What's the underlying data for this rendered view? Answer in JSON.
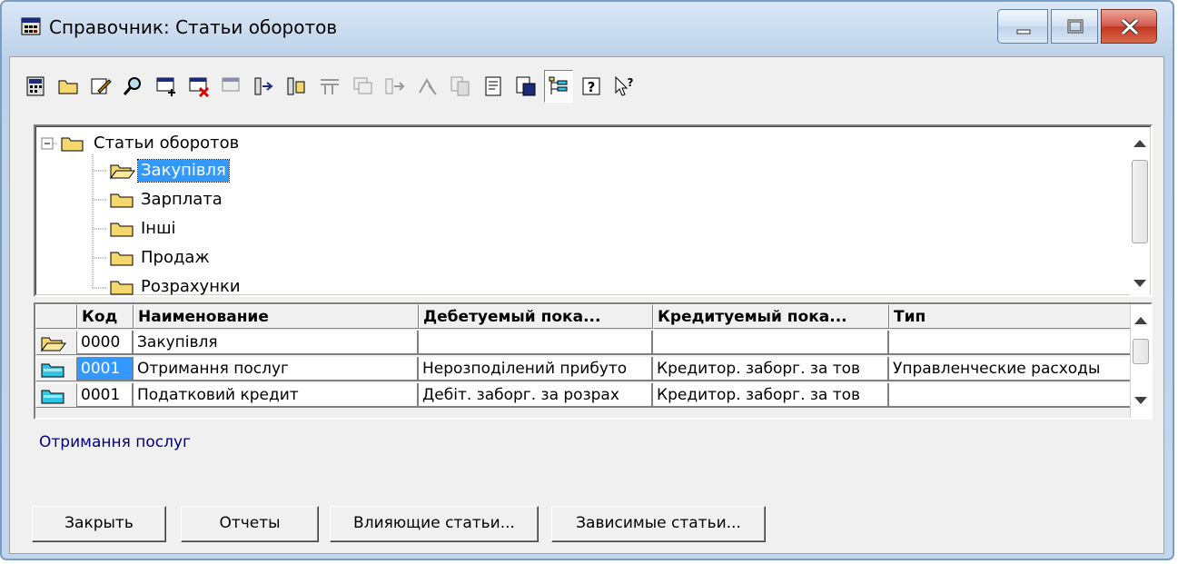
{
  "window": {
    "title": "Справочник: Статьи оборотов"
  },
  "toolbar": {
    "buttons": [
      {
        "icon": "calculator-icon"
      },
      {
        "icon": "folder-icon"
      },
      {
        "icon": "edit-card-icon"
      },
      {
        "icon": "find-icon"
      },
      {
        "icon": "new-record-icon"
      },
      {
        "icon": "delete-record-icon"
      },
      {
        "icon": "copy-record-icon"
      },
      {
        "icon": "move-to-folder-icon"
      },
      {
        "icon": "move-to-parent-icon"
      },
      {
        "icon": "filter-icon"
      },
      {
        "icon": "group-icon"
      },
      {
        "icon": "transfer-icon"
      },
      {
        "icon": "mark-delete-icon"
      },
      {
        "icon": "copy-icon"
      },
      {
        "icon": "document-icon"
      },
      {
        "icon": "export-icon"
      },
      {
        "icon": "tree-view-icon",
        "pressed": true
      },
      {
        "icon": "help-icon"
      },
      {
        "icon": "context-help-icon"
      }
    ]
  },
  "tree": {
    "root": "Статьи оборотов",
    "children": [
      "Закупівля",
      "Зарплата",
      "Інші",
      "Продаж",
      "Розрахунки"
    ],
    "selected_index": 0
  },
  "table": {
    "columns": [
      "Код",
      "Наименование",
      "Дебетуемый пока...",
      "Кредитуемый пока...",
      "Тип"
    ],
    "rows": [
      {
        "icon": "open-folder-icon",
        "code": "0000",
        "name": "Закупівля",
        "debit": "",
        "credit": "",
        "type": ""
      },
      {
        "icon": "element-icon",
        "code": "0001",
        "name": "Отримання послуг",
        "debit": "Нерозподілений прибуто",
        "credit": "Кредитор. заборг. за тов",
        "type": "Управленческие расходы",
        "selected": true
      },
      {
        "icon": "element-icon",
        "code": "0001",
        "name": "Податковий кредит",
        "debit": "Дебіт. заборг. за розрах",
        "credit": "Кредитор. заборг. за тов",
        "type": ""
      }
    ]
  },
  "status": {
    "text": "Отримання послуг"
  },
  "buttons": {
    "close": "Закрыть",
    "reports": "Отчеты",
    "influencing": "Влияющие статьи...",
    "dependent": "Зависимые статьи..."
  },
  "colors": {
    "selection": "#3399ff",
    "status_text": "#000080",
    "folder_yellow": "#f5d76e",
    "element_cyan": "#2ec4e6"
  }
}
